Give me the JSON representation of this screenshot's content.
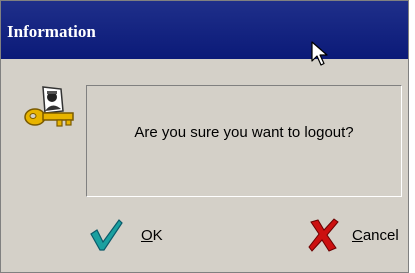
{
  "dialog": {
    "title": "Information",
    "message": "Are you sure you want to logout?",
    "icon": "key-person-icon"
  },
  "buttons": {
    "ok": {
      "mnemonic": "O",
      "rest": "K",
      "icon": "checkmark-icon"
    },
    "cancel": {
      "mnemonic": "C",
      "rest": "ancel",
      "icon": "red-x-icon"
    }
  },
  "colors": {
    "title_bar": "#0b1a78",
    "title_text": "#ffffff",
    "dialog_bg": "#d4d0c8",
    "ok_check": "#1aa0a0",
    "cancel_x": "#cc1010"
  }
}
